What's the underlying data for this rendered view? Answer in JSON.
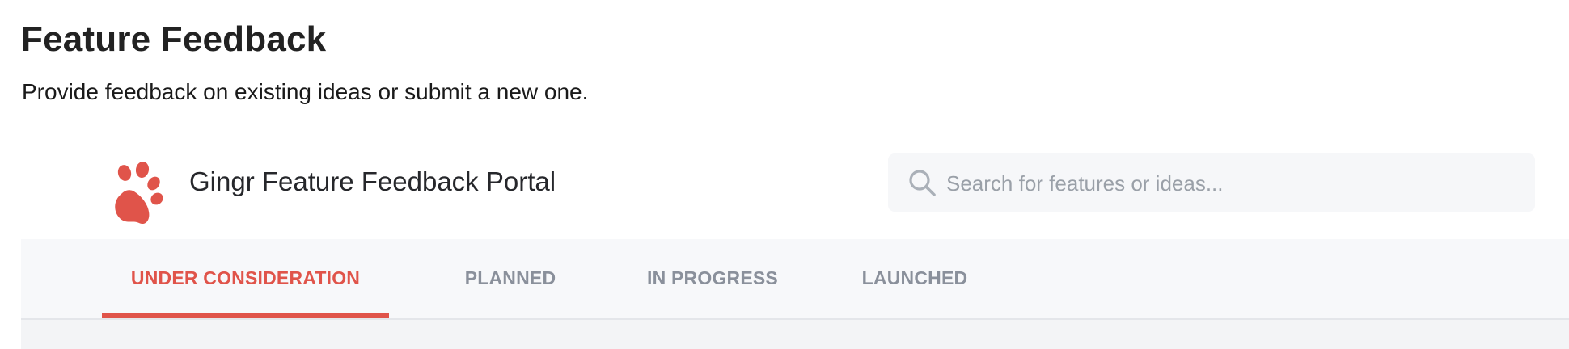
{
  "page": {
    "title": "Feature Feedback",
    "subtitle": "Provide feedback on existing ideas or submit a new one."
  },
  "portal": {
    "title": "Gingr Feature Feedback Portal",
    "logo_icon": "paw-icon",
    "brand_color": "#e0544a"
  },
  "search": {
    "placeholder": "Search for features or ideas...",
    "value": "",
    "icon": "search-icon"
  },
  "tabs": [
    {
      "label": "UNDER CONSIDERATION",
      "active": true
    },
    {
      "label": "PLANNED",
      "active": false
    },
    {
      "label": "IN PROGRESS",
      "active": false
    },
    {
      "label": "LAUNCHED",
      "active": false
    }
  ]
}
